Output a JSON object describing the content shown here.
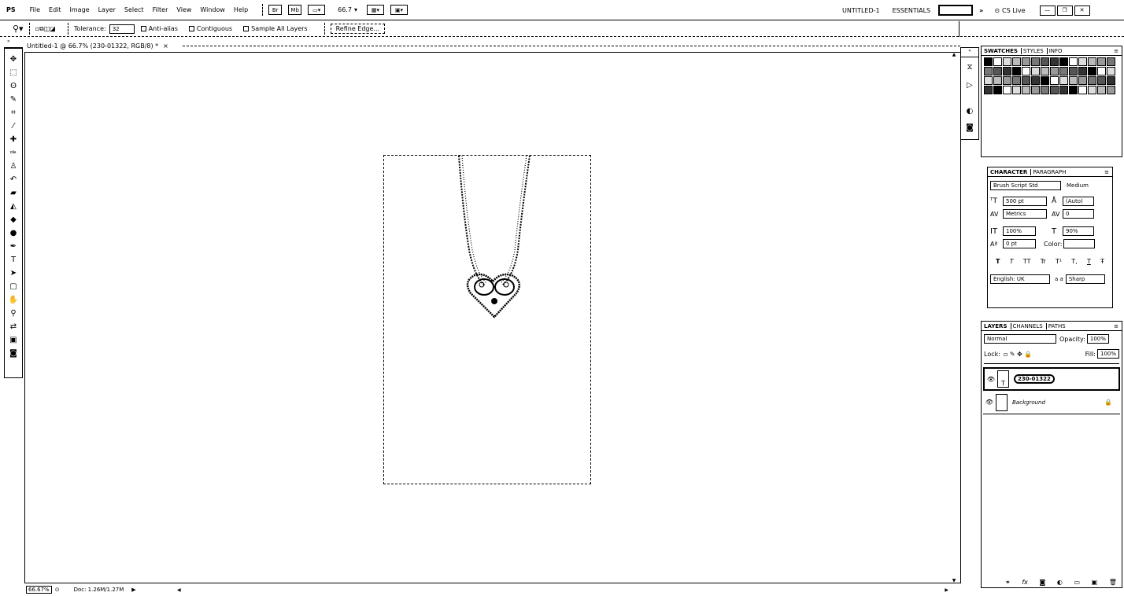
{
  "app": {
    "logo": "PS"
  },
  "menu": [
    "File",
    "Edit",
    "Image",
    "Layer",
    "Select",
    "Filter",
    "View",
    "Window",
    "Help"
  ],
  "menubar_right": {
    "zoom_value": "66.7",
    "doc_name": "UNTITLED-1",
    "workspace": "ESSENTIALS",
    "cs_live": "CS Live"
  },
  "options_bar": {
    "tolerance_label": "Tolerance:",
    "tolerance_value": "32",
    "antialias_label": "Anti-alias",
    "contiguous_label": "Contiguous",
    "sample_all_label": "Sample All Layers",
    "refine_edge_label": "Refine Edge..."
  },
  "document_tab": {
    "title": "Untitled-1 @ 66.7% (230-01322, RGB/8) *"
  },
  "status_bar": {
    "zoom": "66.67%",
    "doc_info": "Doc: 1.26M/1.27M"
  },
  "panels": {
    "swatches_tabs": [
      "SWATCHES",
      "STYLES",
      "INFO"
    ],
    "character_tabs": [
      "CHARACTER",
      "PARAGRAPH"
    ],
    "character": {
      "font_family": "Brush Script Std",
      "font_style": "Medium",
      "font_size": "500 pt",
      "leading": "(Auto)",
      "kerning": "Metrics",
      "tracking": "0",
      "vertical_scale": "100%",
      "horizontal_scale": "90%",
      "baseline_shift": "0 pt",
      "color_label": "Color:",
      "language": "English: UK",
      "antialias": "Sharp",
      "aa_label": "a a",
      "style_buttons": [
        "T",
        "T",
        "TT",
        "Tr",
        "T¹",
        "T,",
        "T",
        "Ŧ"
      ]
    },
    "layers_tabs": [
      "LAYERS",
      "CHANNELS",
      "PATHS"
    ],
    "layers": {
      "blend_mode": "Normal",
      "opacity_label": "Opacity:",
      "opacity": "100%",
      "lock_label": "Lock:",
      "fill_label": "Fill:",
      "fill": "100%",
      "items": [
        {
          "name": "230-01322",
          "selected": true
        },
        {
          "name": "Background",
          "selected": false
        }
      ],
      "footer_icons": [
        "link-icon",
        "fx-icon",
        "mask-icon",
        "adjustment-icon",
        "group-icon",
        "new-layer-icon",
        "trash-icon"
      ]
    }
  },
  "colors": {
    "ink": "#000000",
    "paper": "#ffffff"
  }
}
